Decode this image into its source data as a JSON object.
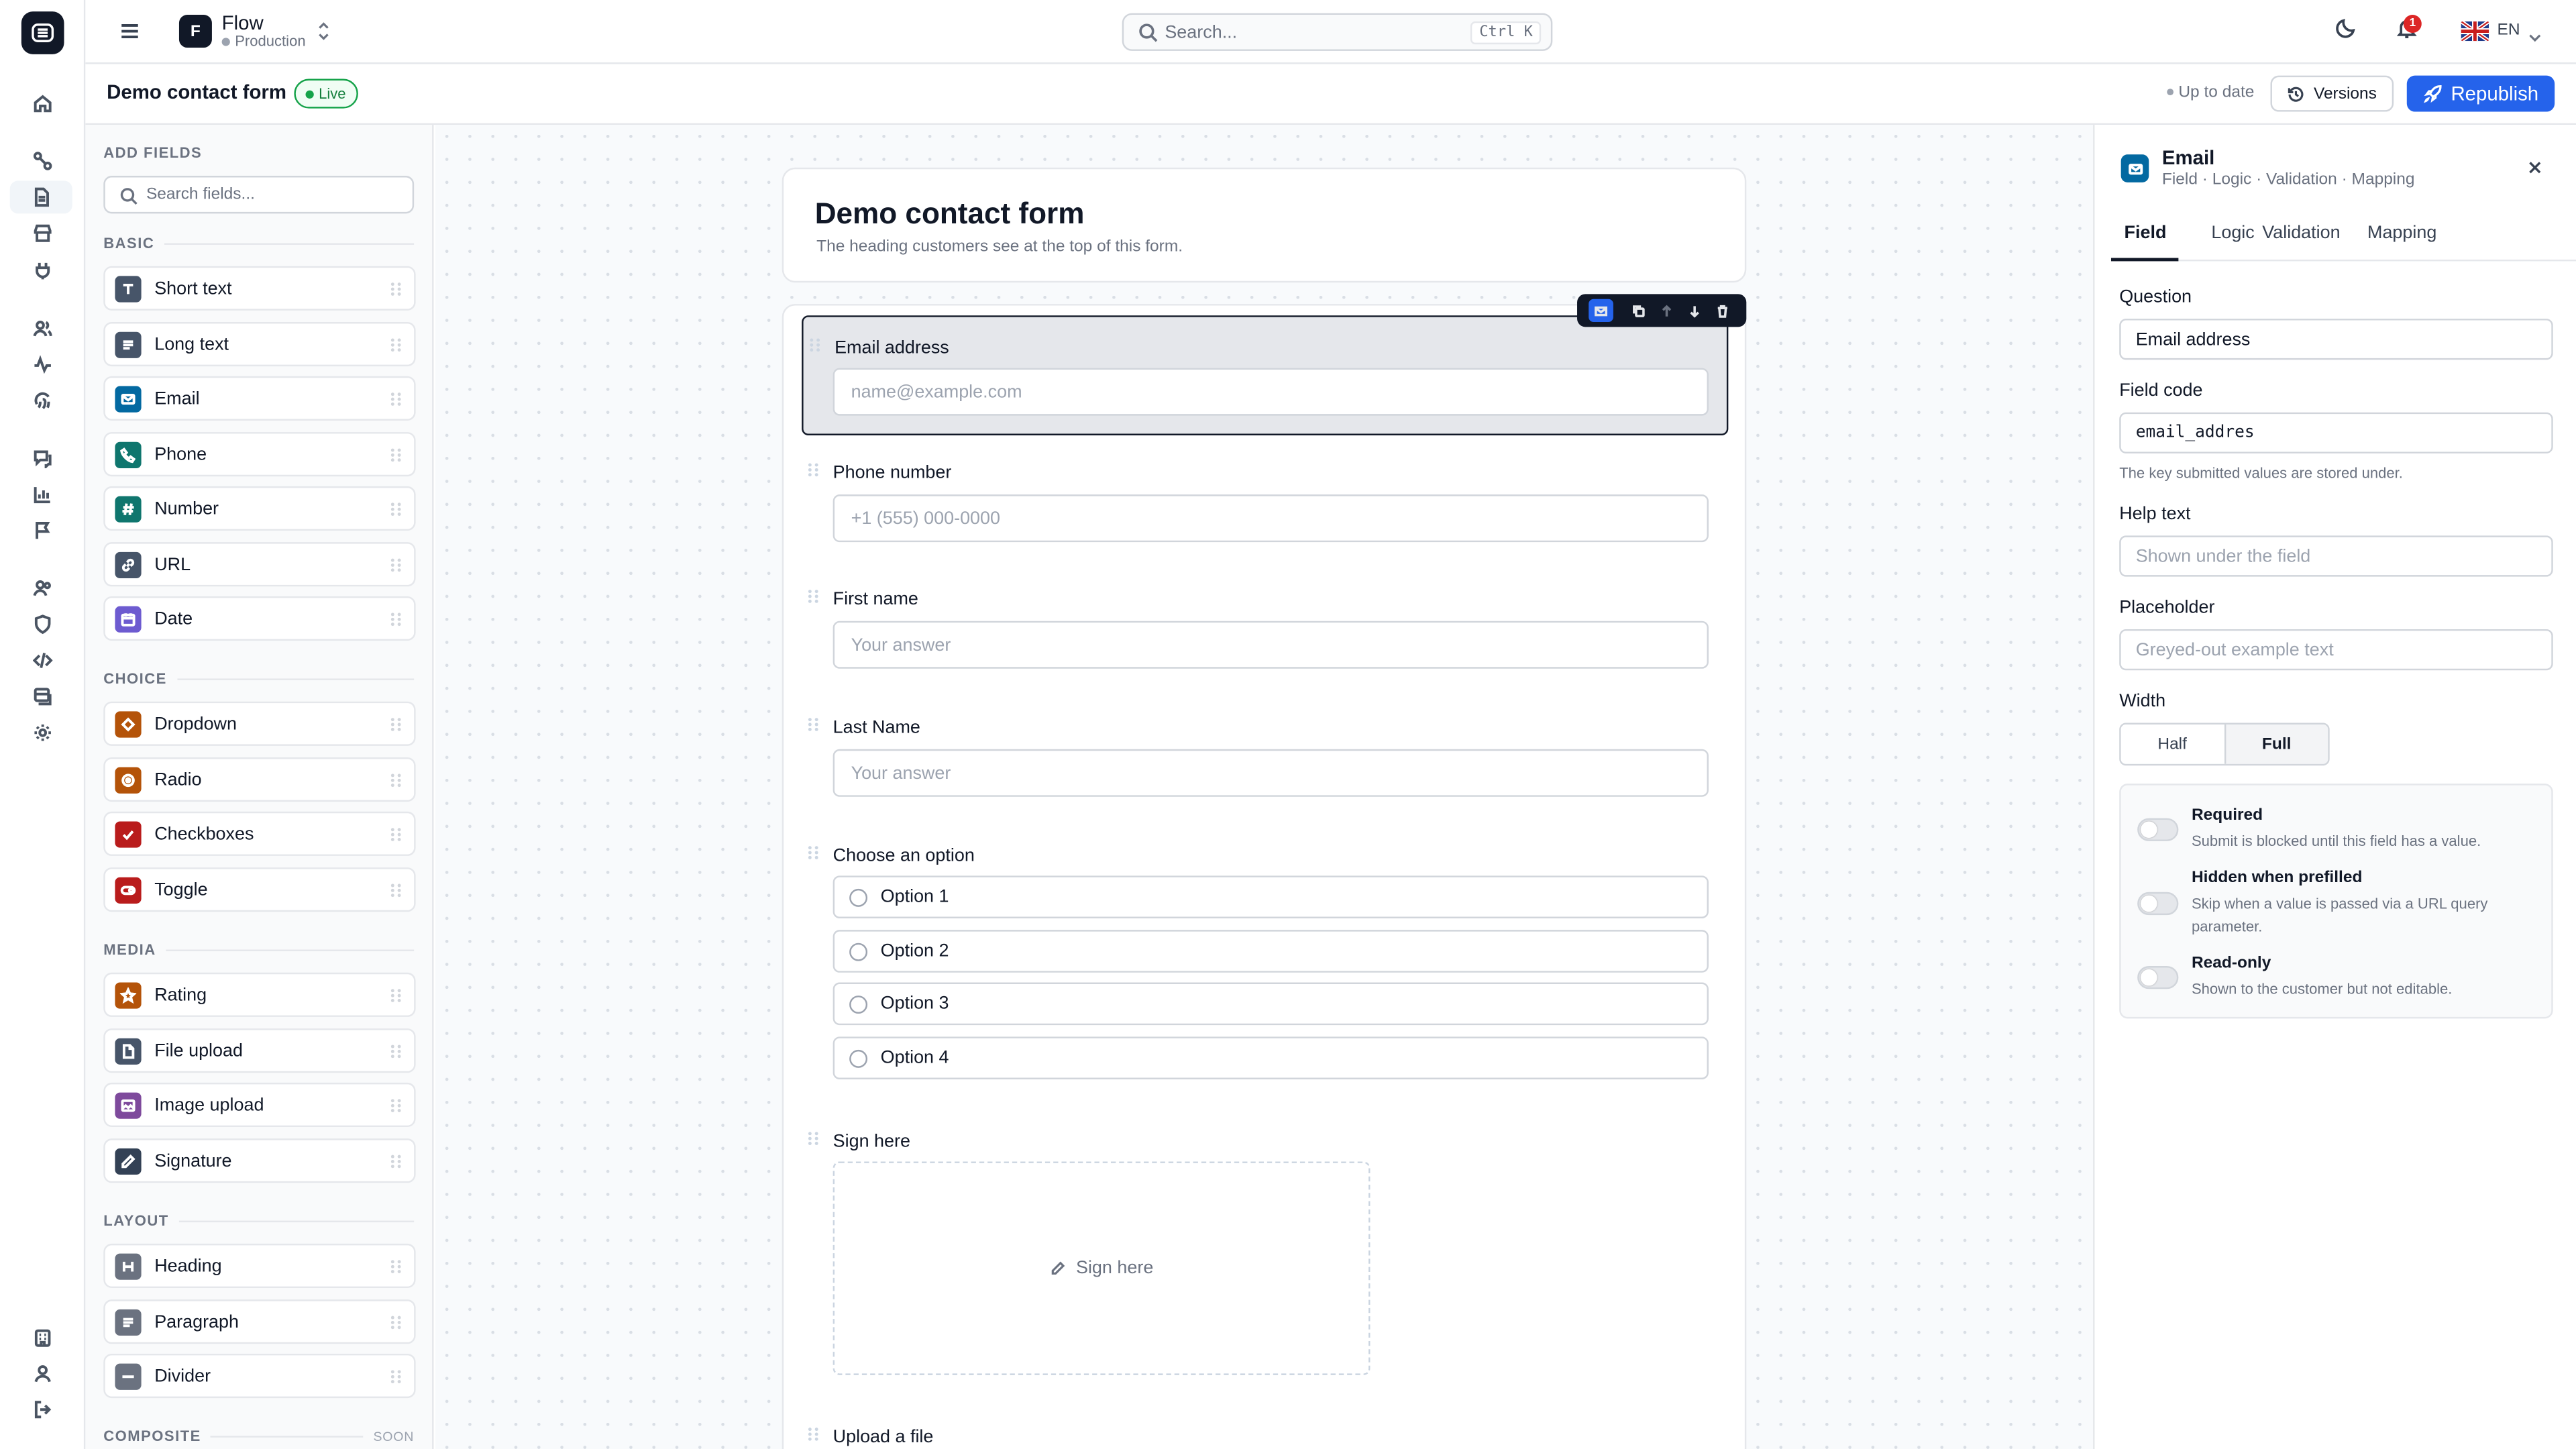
{
  "topbar": {
    "project_initial": "F",
    "project_name": "Flow",
    "project_env": "Production",
    "search_placeholder": "Search...",
    "search_shortcut": "Ctrl K",
    "notification_count": "1",
    "language": "EN"
  },
  "subheader": {
    "form_title": "Demo contact form",
    "status_badge": "Live",
    "sync_status": "Up to date",
    "versions_label": "Versions",
    "republish_label": "Republish"
  },
  "palette": {
    "title": "ADD FIELDS",
    "search_placeholder": "Search fields...",
    "sections": [
      {
        "label": "BASIC",
        "items": [
          {
            "label": "Short text",
            "icon": "text-type-icon",
            "color": "#475569"
          },
          {
            "label": "Long text",
            "icon": "paragraph-lines-icon",
            "color": "#475569"
          },
          {
            "label": "Email",
            "icon": "mail-icon",
            "color": "#0369a1"
          },
          {
            "label": "Phone",
            "icon": "phone-icon",
            "color": "#0f766e"
          },
          {
            "label": "Number",
            "icon": "hash-icon",
            "color": "#0f766e"
          },
          {
            "label": "URL",
            "icon": "link-icon",
            "color": "#475569"
          },
          {
            "label": "Date",
            "icon": "calendar-icon",
            "color": "#6d5bd0"
          }
        ]
      },
      {
        "label": "CHOICE",
        "items": [
          {
            "label": "Dropdown",
            "icon": "diamond-icon",
            "color": "#b45309"
          },
          {
            "label": "Radio",
            "icon": "radio-icon",
            "color": "#b45309"
          },
          {
            "label": "Checkboxes",
            "icon": "check-icon",
            "color": "#b91c1c"
          },
          {
            "label": "Toggle",
            "icon": "toggle-icon",
            "color": "#b91c1c"
          }
        ]
      },
      {
        "label": "MEDIA",
        "items": [
          {
            "label": "Rating",
            "icon": "star-icon",
            "color": "#b45309"
          },
          {
            "label": "File upload",
            "icon": "file-icon",
            "color": "#475569"
          },
          {
            "label": "Image upload",
            "icon": "image-icon",
            "color": "#7e4a9c"
          },
          {
            "label": "Signature",
            "icon": "pen-icon",
            "color": "#334155"
          }
        ]
      },
      {
        "label": "LAYOUT",
        "items": [
          {
            "label": "Heading",
            "icon": "heading-icon",
            "color": "#6b7280"
          },
          {
            "label": "Paragraph",
            "icon": "paragraph-icon",
            "color": "#6b7280"
          },
          {
            "label": "Divider",
            "icon": "divider-icon",
            "color": "#6b7280"
          }
        ]
      },
      {
        "label": "COMPOSITE",
        "badge": "SOON",
        "items": []
      }
    ]
  },
  "form": {
    "title": "Demo contact form",
    "subtitle": "The heading customers see at the top of this form.",
    "fields": [
      {
        "label": "Email address",
        "placeholder": "name@example.com"
      },
      {
        "label": "Phone number",
        "placeholder": "+1 (555) 000-0000"
      },
      {
        "label": "First name",
        "placeholder": "Your answer"
      },
      {
        "label": "Last Name",
        "placeholder": "Your answer"
      }
    ],
    "choice_label": "Choose an option",
    "options": [
      "Option 1",
      "Option 2",
      "Option 3",
      "Option 4"
    ],
    "signature_label": "Sign here",
    "signature_prompt": "Sign here",
    "upload_label": "Upload a file"
  },
  "inspector": {
    "title": "Email",
    "subtitle": "Field · Logic · Validation · Mapping",
    "tabs": [
      "Field",
      "Logic",
      "Validation",
      "Mapping"
    ],
    "question_label": "Question",
    "question_value": "Email address",
    "code_label": "Field code",
    "code_value": "email_addres",
    "code_help": "The key submitted values are stored under.",
    "help_label": "Help text",
    "help_placeholder": "Shown under the field",
    "placeholder_label": "Placeholder",
    "placeholder_placeholder": "Greyed-out example text",
    "width_label": "Width",
    "width_options": [
      "Half",
      "Full"
    ],
    "width_selected": "Full",
    "toggles": [
      {
        "title": "Required",
        "desc": "Submit is blocked until this field has a value.",
        "on": false
      },
      {
        "title": "Hidden when prefilled",
        "desc": "Skip when a value is passed via a URL query parameter.",
        "on": false
      },
      {
        "title": "Read-only",
        "desc": "Shown to the customer but not editable.",
        "on": false
      }
    ]
  }
}
